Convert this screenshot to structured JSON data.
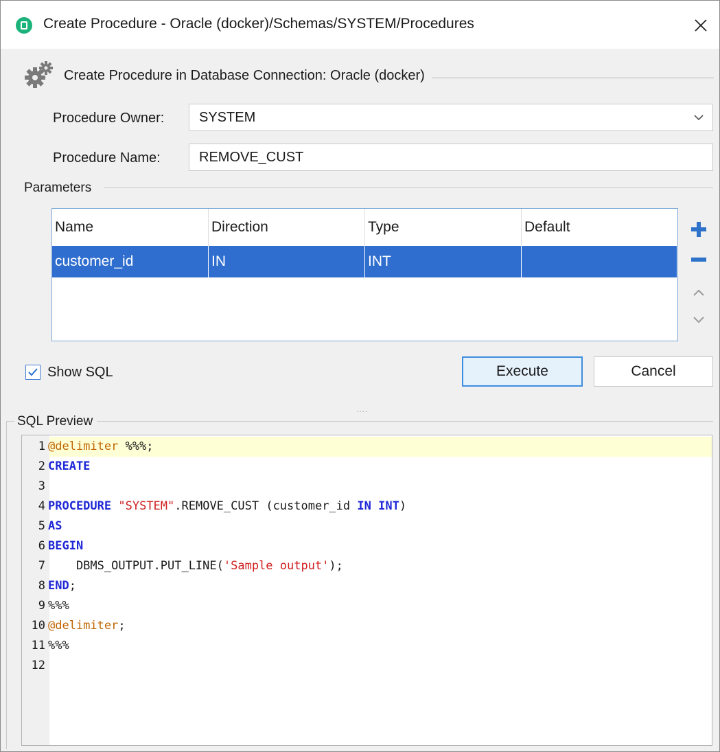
{
  "dialog": {
    "title": "Create Procedure - Oracle (docker)/Schemas/SYSTEM/Procedures",
    "group_title": "Create Procedure in Database Connection: Oracle (docker)"
  },
  "form": {
    "owner_label": "Procedure Owner:",
    "owner_value": "SYSTEM",
    "name_label": "Procedure Name:",
    "name_value": "REMOVE_CUST"
  },
  "parameters": {
    "section_label": "Parameters",
    "columns": [
      "Name",
      "Direction",
      "Type",
      "Default"
    ],
    "rows": [
      {
        "name": "customer_id",
        "direction": "IN",
        "type": "INT",
        "default": ""
      }
    ]
  },
  "controls": {
    "show_sql_label": "Show SQL",
    "show_sql_checked": true,
    "execute_label": "Execute",
    "cancel_label": "Cancel",
    "splitter_text": "....",
    "accent_color": "#2f6ecf"
  },
  "sql_preview": {
    "label": "SQL Preview",
    "line_numbers": [
      "1",
      "2",
      "3",
      "4",
      "5",
      "6",
      "7",
      "8",
      "9",
      "10",
      "11",
      "12"
    ],
    "l1_directive": "@delimiter",
    "l1_rest": " %%%;",
    "l2": "CREATE",
    "l4_kw": "PROCEDURE",
    "l4_sp1": " ",
    "l4_str": "\"SYSTEM\"",
    "l4_mid": ".REMOVE_CUST (customer_id ",
    "l4_in": "IN",
    "l4_sp2": " ",
    "l4_int": "INT",
    "l4_end": ")",
    "l5": "AS",
    "l6": "BEGIN",
    "l7_pre": "    DBMS_OUTPUT.PUT_LINE(",
    "l7_str": "'Sample output'",
    "l7_post": ");",
    "l8_kw": "END",
    "l8_semi": ";",
    "l9": "%%%",
    "l10_directive": "@delimiter",
    "l10_semi": ";",
    "l11": "%%%"
  }
}
